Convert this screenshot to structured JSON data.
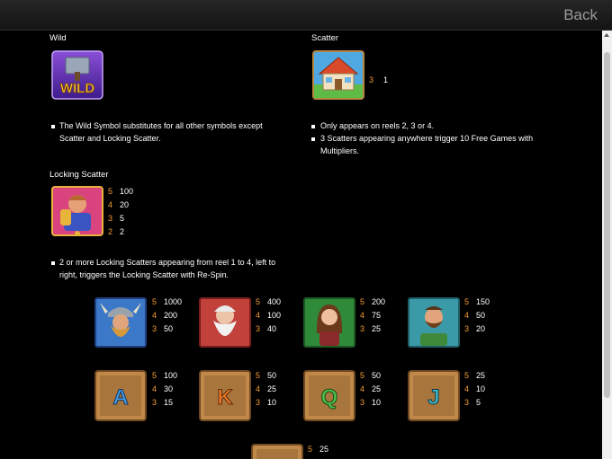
{
  "header": {
    "back_label": "Back"
  },
  "wild": {
    "title": "Wild",
    "icon_text": "WILD",
    "desc": [
      "The Wild Symbol substitutes for all other symbols except",
      "Scatter and Locking Scatter."
    ]
  },
  "scatter": {
    "title": "Scatter",
    "count": "3",
    "value": "1",
    "bullets": [
      [
        "Only appears on reels 2, 3 or 4."
      ],
      [
        "3 Scatters appearing anywhere trigger 10 Free Games with",
        "Multipliers."
      ]
    ]
  },
  "locking": {
    "title": "Locking Scatter",
    "pays": [
      [
        "5",
        "100"
      ],
      [
        "4",
        "20"
      ],
      [
        "3",
        "5"
      ],
      [
        "2",
        "2"
      ]
    ],
    "desc": [
      "2 or more Locking Scatters appearing from reel 1 to 4, left to",
      "right, triggers the Locking Scatter with Re-Spin."
    ]
  },
  "characters": [
    {
      "name": "viking-helmet",
      "pays": [
        [
          "5",
          "1000"
        ],
        [
          "4",
          "200"
        ],
        [
          "3",
          "50"
        ]
      ]
    },
    {
      "name": "old-wizard",
      "pays": [
        [
          "5",
          "400"
        ],
        [
          "4",
          "100"
        ],
        [
          "3",
          "40"
        ]
      ]
    },
    {
      "name": "woman",
      "pays": [
        [
          "5",
          "200"
        ],
        [
          "4",
          "75"
        ],
        [
          "3",
          "25"
        ]
      ]
    },
    {
      "name": "bearded-man",
      "pays": [
        [
          "5",
          "150"
        ],
        [
          "4",
          "50"
        ],
        [
          "3",
          "20"
        ]
      ]
    }
  ],
  "letters": [
    {
      "letter": "A",
      "color": "#3ea0e6",
      "pays": [
        [
          "5",
          "100"
        ],
        [
          "4",
          "30"
        ],
        [
          "3",
          "15"
        ]
      ]
    },
    {
      "letter": "K",
      "color": "#ef7a2a",
      "pays": [
        [
          "5",
          "50"
        ],
        [
          "4",
          "25"
        ],
        [
          "3",
          "10"
        ]
      ]
    },
    {
      "letter": "Q",
      "color": "#4cc24a",
      "pays": [
        [
          "5",
          "50"
        ],
        [
          "4",
          "25"
        ],
        [
          "3",
          "10"
        ]
      ]
    },
    {
      "letter": "J",
      "color": "#3fb8c9",
      "pays": [
        [
          "5",
          "25"
        ],
        [
          "4",
          "10"
        ],
        [
          "3",
          "5"
        ]
      ]
    }
  ],
  "last_row": {
    "pays": [
      [
        "5",
        "25"
      ]
    ]
  }
}
